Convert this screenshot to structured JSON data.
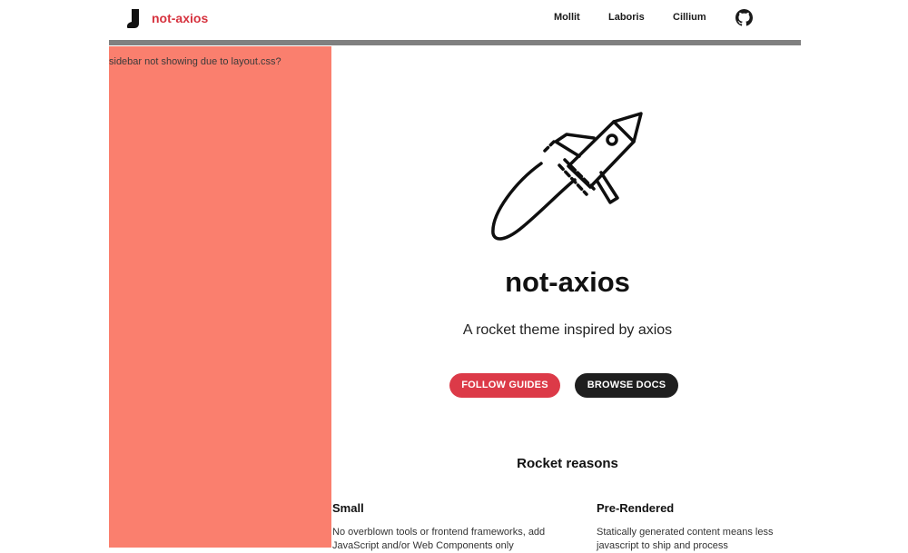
{
  "header": {
    "brand": "not-axios",
    "nav": [
      "Mollit",
      "Laboris",
      "Cillium"
    ],
    "logo_icon": "boot-icon",
    "github_icon": "github-icon"
  },
  "sidebar": {
    "note": "sidebar not showing due to layout.css?"
  },
  "hero": {
    "icon": "rocket-icon",
    "title": "not-axios",
    "subtitle": "A rocket theme inspired by axios",
    "primary_button": "FOLLOW GUIDES",
    "secondary_button": "BROWSE DOCS"
  },
  "reasons": {
    "title": "Rocket reasons",
    "items": [
      {
        "title": "Small",
        "body": "No overblown tools or frontend frameworks, add JavaScript and/or Web Components only"
      },
      {
        "title": "Pre-Rendered",
        "body": "Statically generated content means less javascript to ship and process"
      }
    ]
  },
  "colors": {
    "brand": "#d6323e",
    "sidebar": "#fa7f6e",
    "rule": "#808080",
    "primary_button": "#dc3a48",
    "secondary_button": "#1f1f1f"
  }
}
